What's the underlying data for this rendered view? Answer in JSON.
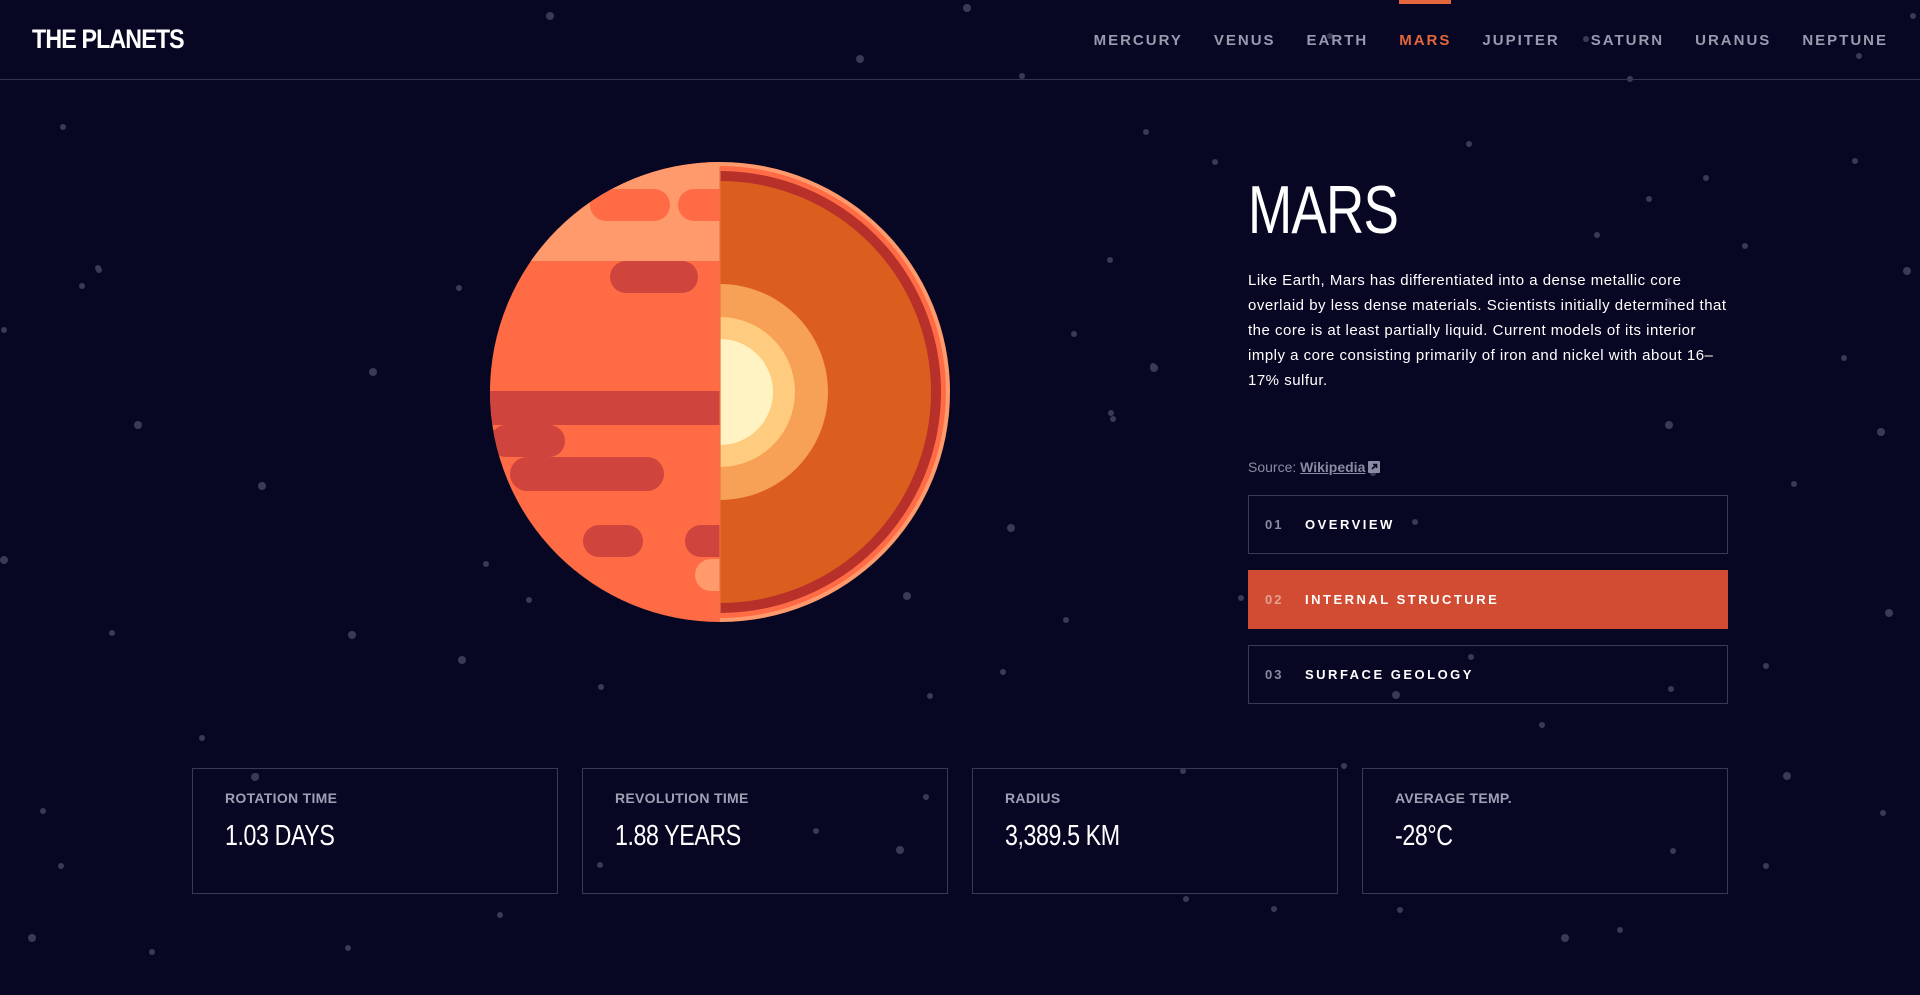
{
  "header": {
    "logo": "THE PLANETS",
    "nav": [
      {
        "label": "MERCURY"
      },
      {
        "label": "VENUS"
      },
      {
        "label": "EARTH"
      },
      {
        "label": "MARS",
        "active": true
      },
      {
        "label": "JUPITER"
      },
      {
        "label": "SATURN"
      },
      {
        "label": "URANUS"
      },
      {
        "label": "NEPTUNE"
      }
    ]
  },
  "planet": {
    "name": "MARS",
    "image_icon": "mars-internal-structure-illustration",
    "description": "Like Earth, Mars has differentiated into a dense metallic core overlaid by less dense materials. Scientists initially determined that the core is at least partially liquid. Current models of its interior imply a core consisting primarily of iron and nickel with about 16–17% sulfur.",
    "source_label": "Source:",
    "source_link": "Wikipedia",
    "source_icon": "external-link-icon"
  },
  "tabs": [
    {
      "num": "01",
      "label": "OVERVIEW"
    },
    {
      "num": "02",
      "label": "INTERNAL STRUCTURE",
      "active": true
    },
    {
      "num": "03",
      "label": "SURFACE GEOLOGY"
    }
  ],
  "stats": [
    {
      "label": "ROTATION TIME",
      "value": "1.03 DAYS"
    },
    {
      "label": "REVOLUTION TIME",
      "value": "1.88 YEARS"
    },
    {
      "label": "RADIUS",
      "value": "3,389.5 KM"
    },
    {
      "label": "AVERAGE TEMP.",
      "value": "-28°C"
    }
  ],
  "colors": {
    "background": "#070724",
    "accent": "#E3663D",
    "active_tab": "#D14C32",
    "border": "#39394F"
  }
}
